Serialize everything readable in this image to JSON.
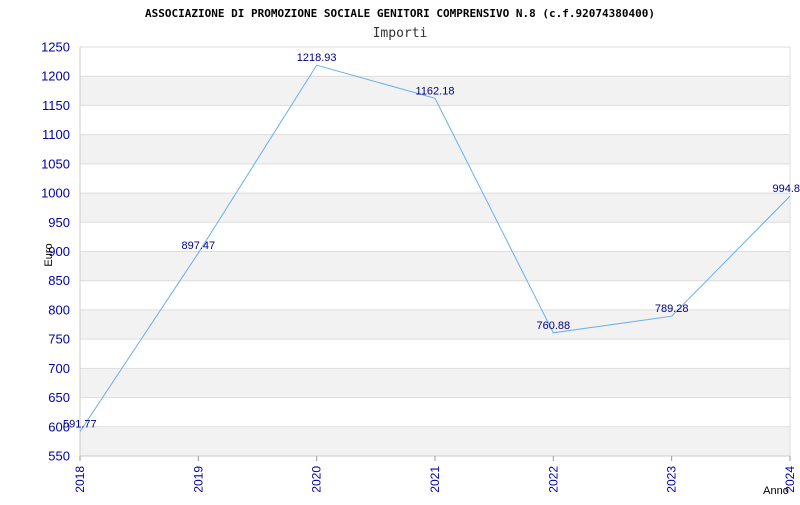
{
  "chart_data": {
    "type": "line",
    "title": "ASSOCIAZIONE DI PROMOZIONE SOCIALE GENITORI COMPRENSIVO N.8 (c.f.92074380400)",
    "subtitle": "Importi",
    "xlabel": "Anno",
    "ylabel": "Euro",
    "categories": [
      "2018",
      "2019",
      "2020",
      "2021",
      "2022",
      "2023",
      "2024"
    ],
    "series": [
      {
        "values": [
          591.77,
          897.47,
          1218.93,
          1162.18,
          760.88,
          789.28,
          994.8
        ],
        "labels": [
          "591.77",
          "897.47",
          "1218.93",
          "1162.18",
          "760.88",
          "789.28",
          "994.8"
        ]
      }
    ],
    "ylim": [
      550,
      1250
    ],
    "yticks": [
      550,
      600,
      650,
      700,
      750,
      800,
      850,
      900,
      950,
      1000,
      1050,
      1100,
      1150,
      1200,
      1250
    ],
    "grid": true,
    "colors": {
      "line": "#6aaee8",
      "band": "#f2f2f2",
      "gridline": "#dddddd",
      "tick_text": "#0000aa",
      "label_text": "#000080"
    }
  }
}
